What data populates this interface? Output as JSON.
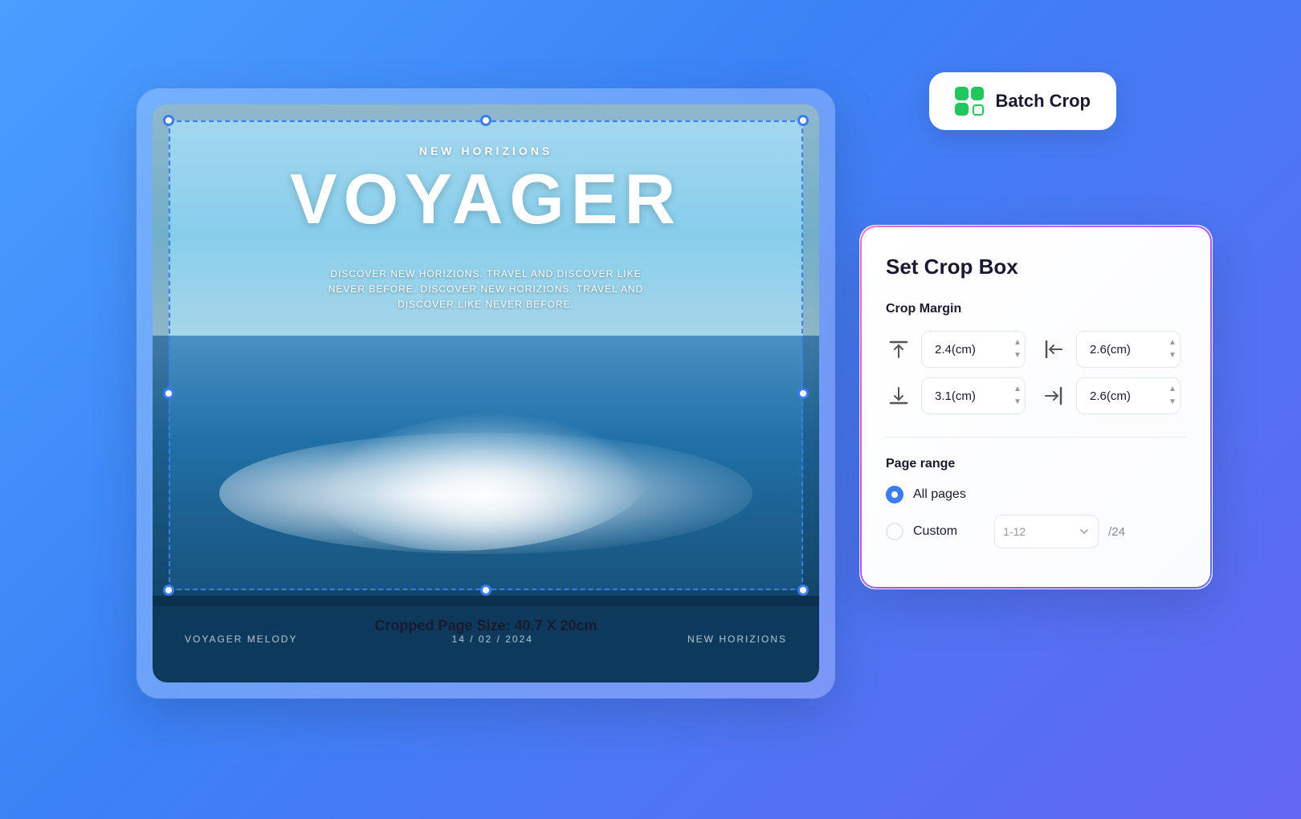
{
  "scene": {
    "pdf_card": {
      "pdf_subtitle": "NEW HORIZIONS",
      "pdf_title": "VOYAGER",
      "pdf_body": "DISCOVER NEW HORIZIONS. TRAVEL AND DISCOVER LIKE NEVER BEFORE. DISCOVER NEW HORIZIONS. TRAVEL AND DISCOVER LIKE NEVER BEFORE.",
      "bottom_left": "VOYAGER MELODY",
      "bottom_center": "14 / 02 / 2024",
      "bottom_right": "NEW HORIZIONS",
      "crop_size_label": "Cropped Page Size: 40.7 X 20cm"
    },
    "batch_crop_button": {
      "label": "Batch Crop"
    },
    "crop_panel": {
      "title": "Set Crop Box",
      "crop_margin_label": "Crop Margin",
      "top_margin": "2.4(cm)",
      "left_margin": "2.6(cm)",
      "bottom_margin": "3.1(cm)",
      "right_margin": "2.6(cm)",
      "page_range_label": "Page range",
      "all_pages_label": "All pages",
      "custom_label": "Custom",
      "custom_range_placeholder": "1-12",
      "total_pages": "/24"
    }
  }
}
